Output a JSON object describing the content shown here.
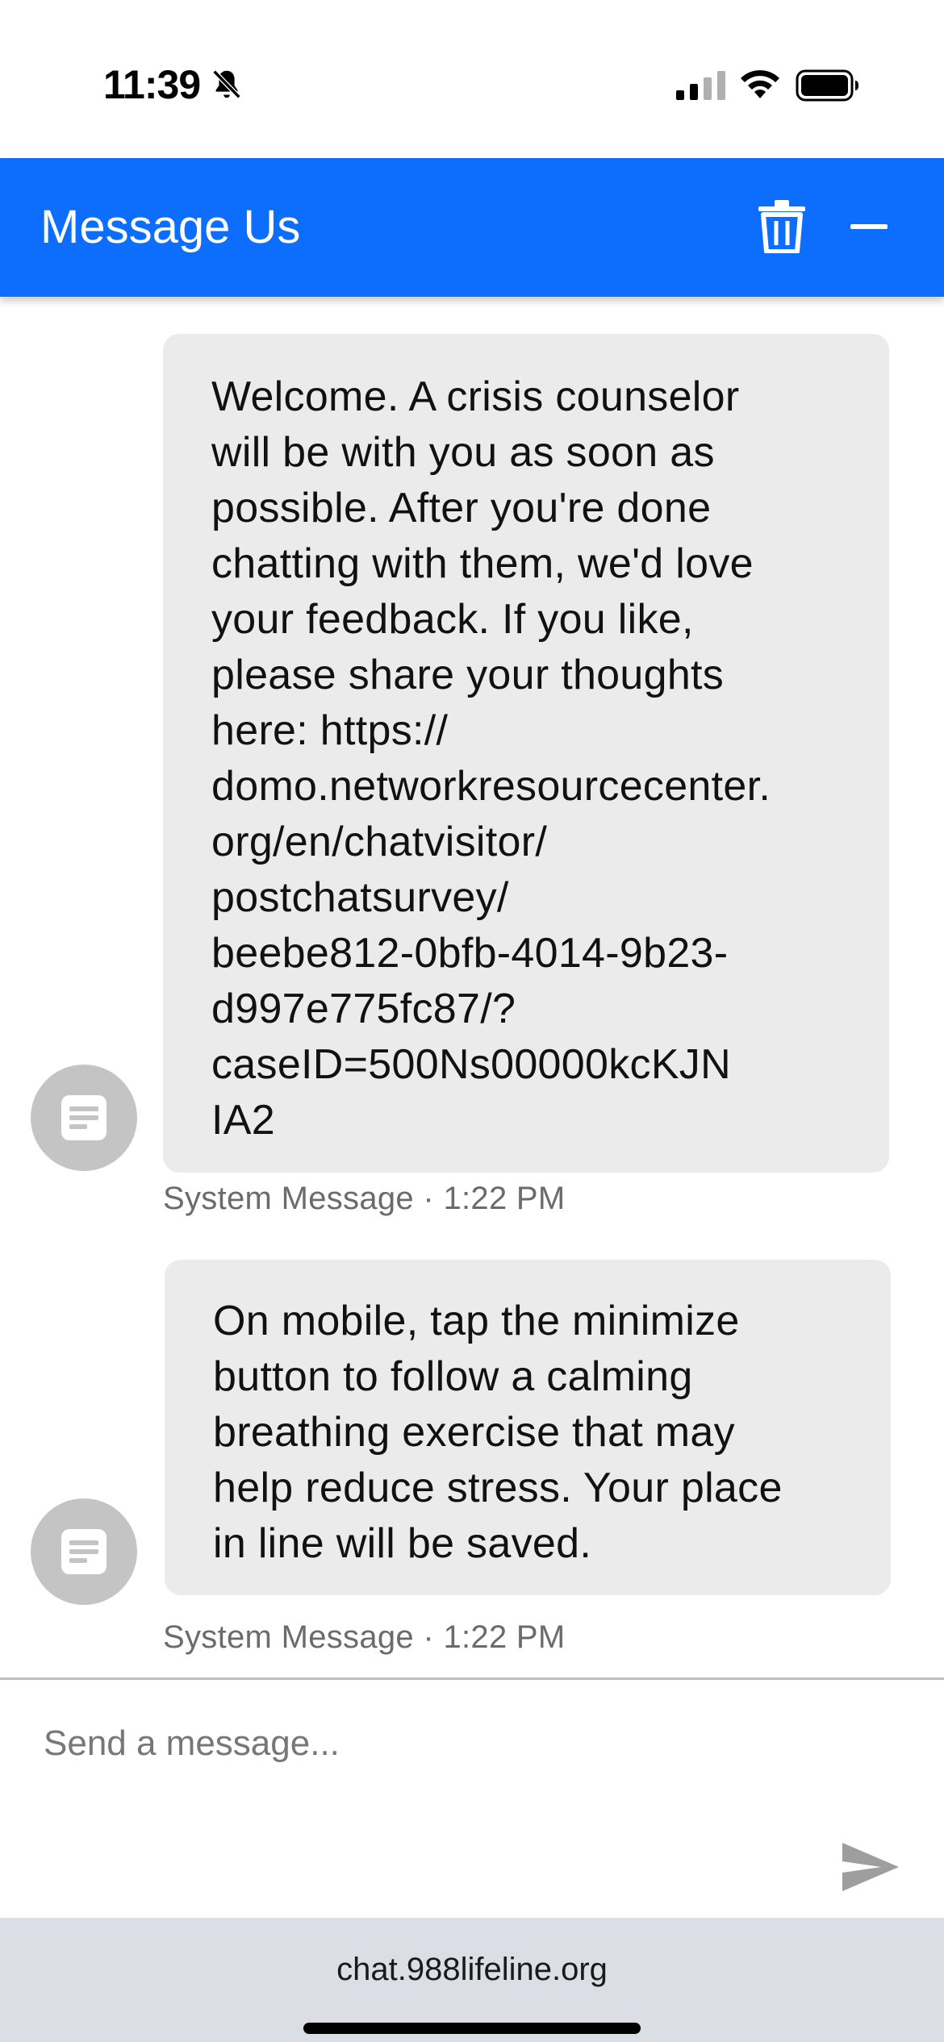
{
  "status_bar": {
    "time": "11:39",
    "icons": [
      "bell-slash-icon",
      "signal-icon",
      "wifi-icon",
      "battery-icon"
    ]
  },
  "header": {
    "title": "Message Us",
    "icons": [
      "trash-icon",
      "minimize-icon"
    ],
    "background_color": "#0d6efd"
  },
  "messages": [
    {
      "lines": [
        "Welcome. A crisis counselor",
        "will be with you as soon as",
        "possible. After you're done",
        "chatting with them, we'd love",
        "your feedback. If you like,",
        "please share your thoughts",
        "here: https://",
        "domo.networkresourcecenter.",
        "org/en/chatvisitor/",
        "postchatsurvey/",
        "beebe812-0bfb-4014-9b23-",
        "d997e775fc87/?",
        "caseID=500Ns00000kcKJN",
        "IA2"
      ],
      "sender": "System Message",
      "separator": "·",
      "time": "1:22 PM"
    },
    {
      "lines": [
        "On mobile, tap the minimize",
        "button to follow a calming",
        "breathing exercise that may",
        "help reduce stress. Your place",
        "in line will be saved."
      ],
      "sender": "System Message",
      "separator": "·",
      "time": "1:22 PM"
    }
  ],
  "composer": {
    "value": "",
    "placeholder": "Send a message...",
    "send_icon": "send-icon"
  },
  "browser": {
    "url": "chat.988lifeline.org"
  }
}
